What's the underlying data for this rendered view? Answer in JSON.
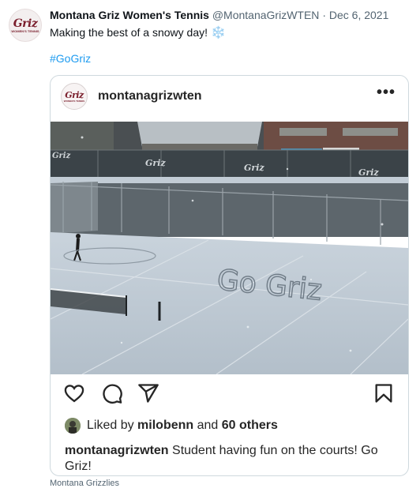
{
  "tweet": {
    "author_name": "Montana Griz Women's Tennis",
    "handle": "@MontanaGrizWTEN",
    "separator": "·",
    "date": "Dec 6, 2021",
    "text": "Making the best of a snowy day!",
    "emoji": "❄️",
    "hashtag": "#GoGriz",
    "avatar_logo_text": "Griz",
    "avatar_logo_subtext": "WOMEN'S TENNIS"
  },
  "embed": {
    "username": "montanagrizwten",
    "more_icon": "•••",
    "photo_court_text": "Go Griz",
    "icons": [
      "heart-icon",
      "comment-icon",
      "share-icon",
      "bookmark-icon"
    ],
    "likes_prefix": "Liked by",
    "likes_user": "milobenn",
    "likes_and": "and",
    "likes_others": "60 others",
    "caption_user": "montanagrizwten",
    "caption_text": "Student having fun on the courts! Go Griz!"
  },
  "footer": {
    "source": "Montana Grizzlies"
  }
}
